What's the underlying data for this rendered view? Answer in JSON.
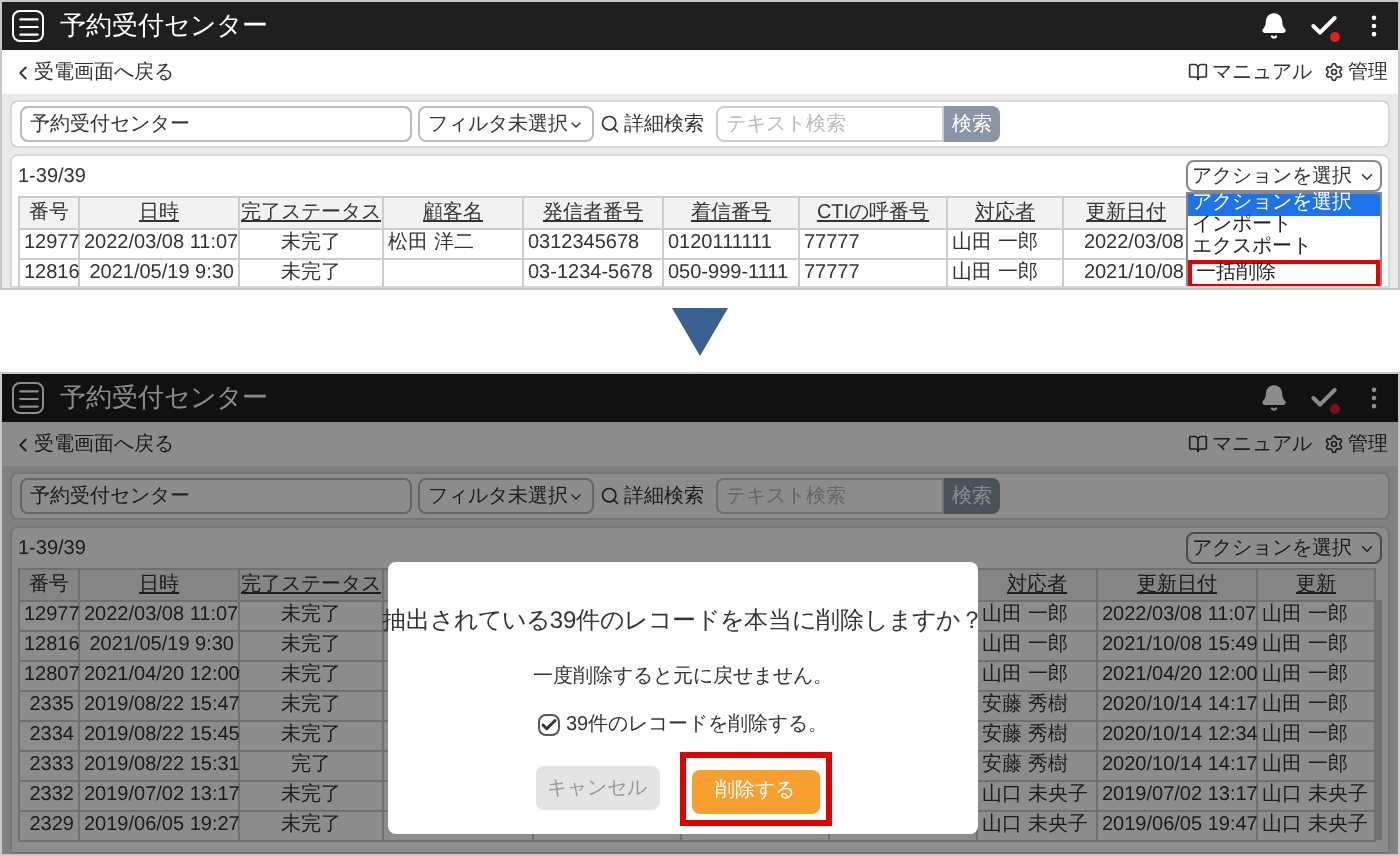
{
  "steps": [
    {
      "app_bar": {
        "title": "予約受付センター"
      },
      "back_link": "受電画面へ戻る",
      "manual_link": "マニュアル",
      "admin_link": "管理",
      "search": {
        "center": "予約受付センター",
        "filter": "フィルタ未選択",
        "advanced": "詳細検索",
        "placeholder": "テキスト検索",
        "button": "検索"
      },
      "count": "1-39/39",
      "action_select": "アクションを選択",
      "action_menu": [
        {
          "label": "アクションを選択",
          "selected": true,
          "highlighted": false
        },
        {
          "label": "インポート",
          "selected": false,
          "highlighted": false
        },
        {
          "label": "エクスポート",
          "selected": false,
          "highlighted": false
        },
        {
          "label": "一括削除",
          "selected": false,
          "highlighted": true
        }
      ],
      "table": {
        "columns": [
          {
            "label": "番号",
            "sortable": false
          },
          {
            "label": "日時",
            "sortable": true
          },
          {
            "label": "完了ステータス",
            "sortable": true
          },
          {
            "label": "顧客名",
            "sortable": true
          },
          {
            "label": "発信者番号",
            "sortable": true
          },
          {
            "label": "着信番号",
            "sortable": true
          },
          {
            "label": "CTIの呼番号",
            "sortable": true
          },
          {
            "label": "対応者",
            "sortable": true
          },
          {
            "label": "更新日付",
            "sortable": true
          }
        ],
        "rows": [
          [
            "12977",
            "2022/03/08 11:07",
            "未完了",
            "松田 洋二",
            "0312345678",
            "0120111111",
            "77777",
            "山田 一郎",
            "2022/03/08"
          ],
          [
            "12816",
            "2021/05/19 9:30",
            "未完了",
            null,
            "03-1234-5678",
            "050-999-1111",
            "77777",
            "山田 一郎",
            "2021/10/08"
          ]
        ]
      }
    },
    {
      "app_bar": {
        "title": "予約受付センター"
      },
      "back_link": "受電画面へ戻る",
      "manual_link": "マニュアル",
      "admin_link": "管理",
      "search": {
        "center": "予約受付センター",
        "filter": "フィルタ未選択",
        "advanced": "詳細検索",
        "placeholder": "テキスト検索",
        "button": "検索"
      },
      "count": "1-39/39",
      "action_select": "アクションを選択",
      "table": {
        "columns": [
          {
            "label": "番号",
            "sortable": false
          },
          {
            "label": "日時",
            "sortable": true
          },
          {
            "label": "完了ステータス",
            "sortable": true
          },
          null,
          null,
          null,
          null,
          {
            "label": "対応者",
            "sortable": true
          },
          {
            "label": "更新日付",
            "sortable": true
          },
          {
            "label": "更新",
            "sortable": true
          }
        ],
        "rows": [
          [
            "12977",
            "2022/03/08 11:07",
            "未完了",
            null,
            null,
            null,
            null,
            "山田 一郎",
            "2022/03/08 11:07",
            "山田 一郎"
          ],
          [
            "12816",
            "2021/05/19 9:30",
            "未完了",
            null,
            null,
            null,
            null,
            "山田 一郎",
            "2021/10/08 15:49",
            "山田 一郎"
          ],
          [
            "12807",
            "2021/04/20 12:00",
            "未完了",
            null,
            null,
            null,
            null,
            "山田 一郎",
            "2021/04/20 12:00",
            "山田 一郎"
          ],
          [
            "2335",
            "2019/08/22 15:47",
            "未完了",
            null,
            null,
            null,
            null,
            "安藤 秀樹",
            "2020/10/14 14:17",
            "山田 一郎"
          ],
          [
            "2334",
            "2019/08/22 15:45",
            "未完了",
            null,
            null,
            null,
            null,
            "安藤 秀樹",
            "2020/10/14 12:34",
            "山田 一郎"
          ],
          [
            "2333",
            "2019/08/22 15:31",
            "完了",
            null,
            null,
            null,
            null,
            "安藤 秀樹",
            "2020/10/14 14:17",
            "山田 一郎"
          ],
          [
            "2332",
            "2019/07/02 13:17",
            "未完了",
            null,
            null,
            null,
            null,
            "山口 未央子",
            "2019/07/02 13:17",
            "山口 未央子"
          ],
          [
            "2329",
            "2019/06/05 19:27",
            "未完了",
            null,
            null,
            null,
            null,
            "山口 未央子",
            "2019/06/05 19:47",
            "山口 未央子"
          ]
        ]
      },
      "dialog": {
        "title": "抽出されている39件のレコードを本当に削除しますか？",
        "message": "一度削除すると元に戻せません。",
        "confirm_check": {
          "label": "39件のレコードを削除する。",
          "checked": true
        },
        "cancel": "キャンセル",
        "confirm": "削除する",
        "confirm_highlighted": true
      }
    }
  ]
}
